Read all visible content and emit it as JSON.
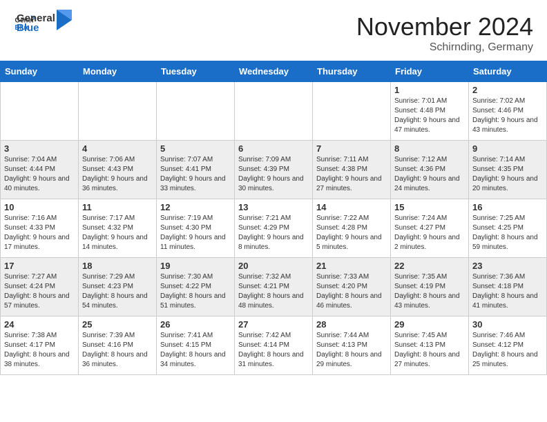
{
  "header": {
    "logo": {
      "text_general": "General",
      "text_blue": "Blue",
      "icon_label": "generalblue-logo-icon"
    },
    "month_title": "November 2024",
    "location": "Schirnding, Germany"
  },
  "calendar": {
    "days_of_week": [
      "Sunday",
      "Monday",
      "Tuesday",
      "Wednesday",
      "Thursday",
      "Friday",
      "Saturday"
    ],
    "rows": [
      [
        {
          "day": "",
          "info": ""
        },
        {
          "day": "",
          "info": ""
        },
        {
          "day": "",
          "info": ""
        },
        {
          "day": "",
          "info": ""
        },
        {
          "day": "",
          "info": ""
        },
        {
          "day": "1",
          "info": "Sunrise: 7:01 AM\nSunset: 4:48 PM\nDaylight: 9 hours and 47 minutes."
        },
        {
          "day": "2",
          "info": "Sunrise: 7:02 AM\nSunset: 4:46 PM\nDaylight: 9 hours and 43 minutes."
        }
      ],
      [
        {
          "day": "3",
          "info": "Sunrise: 7:04 AM\nSunset: 4:44 PM\nDaylight: 9 hours and 40 minutes."
        },
        {
          "day": "4",
          "info": "Sunrise: 7:06 AM\nSunset: 4:43 PM\nDaylight: 9 hours and 36 minutes."
        },
        {
          "day": "5",
          "info": "Sunrise: 7:07 AM\nSunset: 4:41 PM\nDaylight: 9 hours and 33 minutes."
        },
        {
          "day": "6",
          "info": "Sunrise: 7:09 AM\nSunset: 4:39 PM\nDaylight: 9 hours and 30 minutes."
        },
        {
          "day": "7",
          "info": "Sunrise: 7:11 AM\nSunset: 4:38 PM\nDaylight: 9 hours and 27 minutes."
        },
        {
          "day": "8",
          "info": "Sunrise: 7:12 AM\nSunset: 4:36 PM\nDaylight: 9 hours and 24 minutes."
        },
        {
          "day": "9",
          "info": "Sunrise: 7:14 AM\nSunset: 4:35 PM\nDaylight: 9 hours and 20 minutes."
        }
      ],
      [
        {
          "day": "10",
          "info": "Sunrise: 7:16 AM\nSunset: 4:33 PM\nDaylight: 9 hours and 17 minutes."
        },
        {
          "day": "11",
          "info": "Sunrise: 7:17 AM\nSunset: 4:32 PM\nDaylight: 9 hours and 14 minutes."
        },
        {
          "day": "12",
          "info": "Sunrise: 7:19 AM\nSunset: 4:30 PM\nDaylight: 9 hours and 11 minutes."
        },
        {
          "day": "13",
          "info": "Sunrise: 7:21 AM\nSunset: 4:29 PM\nDaylight: 9 hours and 8 minutes."
        },
        {
          "day": "14",
          "info": "Sunrise: 7:22 AM\nSunset: 4:28 PM\nDaylight: 9 hours and 5 minutes."
        },
        {
          "day": "15",
          "info": "Sunrise: 7:24 AM\nSunset: 4:27 PM\nDaylight: 9 hours and 2 minutes."
        },
        {
          "day": "16",
          "info": "Sunrise: 7:25 AM\nSunset: 4:25 PM\nDaylight: 8 hours and 59 minutes."
        }
      ],
      [
        {
          "day": "17",
          "info": "Sunrise: 7:27 AM\nSunset: 4:24 PM\nDaylight: 8 hours and 57 minutes."
        },
        {
          "day": "18",
          "info": "Sunrise: 7:29 AM\nSunset: 4:23 PM\nDaylight: 8 hours and 54 minutes."
        },
        {
          "day": "19",
          "info": "Sunrise: 7:30 AM\nSunset: 4:22 PM\nDaylight: 8 hours and 51 minutes."
        },
        {
          "day": "20",
          "info": "Sunrise: 7:32 AM\nSunset: 4:21 PM\nDaylight: 8 hours and 48 minutes."
        },
        {
          "day": "21",
          "info": "Sunrise: 7:33 AM\nSunset: 4:20 PM\nDaylight: 8 hours and 46 minutes."
        },
        {
          "day": "22",
          "info": "Sunrise: 7:35 AM\nSunset: 4:19 PM\nDaylight: 8 hours and 43 minutes."
        },
        {
          "day": "23",
          "info": "Sunrise: 7:36 AM\nSunset: 4:18 PM\nDaylight: 8 hours and 41 minutes."
        }
      ],
      [
        {
          "day": "24",
          "info": "Sunrise: 7:38 AM\nSunset: 4:17 PM\nDaylight: 8 hours and 38 minutes."
        },
        {
          "day": "25",
          "info": "Sunrise: 7:39 AM\nSunset: 4:16 PM\nDaylight: 8 hours and 36 minutes."
        },
        {
          "day": "26",
          "info": "Sunrise: 7:41 AM\nSunset: 4:15 PM\nDaylight: 8 hours and 34 minutes."
        },
        {
          "day": "27",
          "info": "Sunrise: 7:42 AM\nSunset: 4:14 PM\nDaylight: 8 hours and 31 minutes."
        },
        {
          "day": "28",
          "info": "Sunrise: 7:44 AM\nSunset: 4:13 PM\nDaylight: 8 hours and 29 minutes."
        },
        {
          "day": "29",
          "info": "Sunrise: 7:45 AM\nSunset: 4:13 PM\nDaylight: 8 hours and 27 minutes."
        },
        {
          "day": "30",
          "info": "Sunrise: 7:46 AM\nSunset: 4:12 PM\nDaylight: 8 hours and 25 minutes."
        }
      ]
    ]
  }
}
